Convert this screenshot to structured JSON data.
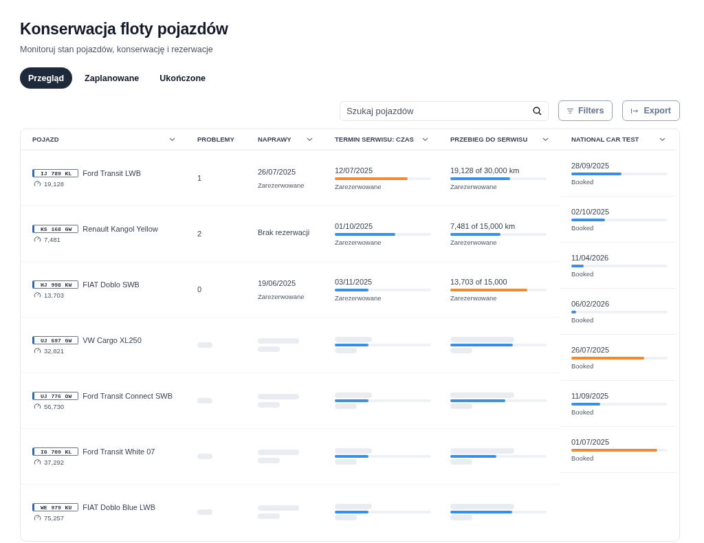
{
  "page": {
    "title": "Konserwacja floty pojazdów",
    "subtitle": "Monitoruj stan pojazdów, konserwację i rezerwacje"
  },
  "tabs": [
    {
      "label": "Przegląd",
      "selected": true
    },
    {
      "label": "Zaplanowane",
      "selected": false
    },
    {
      "label": "Ukończone",
      "selected": false
    }
  ],
  "search": {
    "placeholder": "Szukaj pojazdów"
  },
  "buttons": [
    {
      "label": "Filters",
      "kind": "filter"
    },
    {
      "label": "Export",
      "kind": "export"
    }
  ],
  "table": {
    "columns": [
      {
        "label": "POJAZD"
      },
      {
        "label": "PROBLEMY"
      },
      {
        "label": "NAPRAWY"
      },
      {
        "label": "TERMIN SERWISU: CZAS"
      },
      {
        "label": "PRZEBIEG DO SERWISU"
      },
      {
        "label": "NATIONAL CAR TEST"
      }
    ],
    "rows": [
      {
        "plate": "IJ 789 KL",
        "name": "Ford Transit LWB",
        "odometer": "19,128",
        "loading": false,
        "problems": "1",
        "repair": {
          "date": "26/07/2025",
          "status": "Zarezerwowane"
        },
        "service_time": {
          "text": "12/07/2025",
          "level": 0.76,
          "color": "#f08a35",
          "status": "Zarezerwowane"
        },
        "mileage": {
          "text": "19,128 of 30,000 km",
          "level": 0.62,
          "color": "#3b8ee0",
          "status": "Zarezerwowane"
        }
      },
      {
        "plate": "KS 168 GW",
        "name": "Renault Kangol Yellow",
        "odometer": "7,481",
        "loading": false,
        "problems": "2",
        "repair": {
          "text": "Brak rezerwacji"
        },
        "service_time": {
          "text": "01/10/2025",
          "level": 0.63,
          "color": "#3b8ee0",
          "status": "Zarezerwowane"
        },
        "mileage": {
          "text": "7,481 of 15,000 km",
          "level": 0.52,
          "color": "#3b8ee0",
          "status": "Zarezerwowane"
        }
      },
      {
        "plate": "HJ 998 KW",
        "name": "FIAT Doblo SWB",
        "odometer": "13,703",
        "loading": false,
        "problems": "0",
        "repair": {
          "date": "19/06/2025",
          "status": "Zarezerwowane"
        },
        "service_time": {
          "text": "03/11/2025",
          "level": 0.35,
          "color": "#3b8ee0",
          "status": "Zarezerwowane"
        },
        "mileage": {
          "text": "13,703 of 15,000",
          "level": 0.8,
          "color": "#f08a35",
          "status": "Zarezerwowane"
        }
      },
      {
        "plate": "UJ 597 GW",
        "name": "VW Cargo XL250",
        "odometer": "32,821",
        "loading": true,
        "service_time": {
          "level": 0.35,
          "color": "#3b8ee0"
        },
        "mileage": {
          "level": 0.65,
          "color": "#3b8ee0"
        }
      },
      {
        "plate": "UJ 776 OW",
        "name": "Ford Transit Connect SWB",
        "odometer": "56,730",
        "loading": true,
        "service_time": {
          "level": 0.35,
          "color": "#3b8ee0"
        },
        "mileage": {
          "level": 0.57,
          "color": "#3b8ee0"
        }
      },
      {
        "plate": "IG 709 KL",
        "name": "Ford Transit White 07",
        "odometer": "37,292",
        "loading": true,
        "service_time": {
          "level": 0.35,
          "color": "#3b8ee0"
        },
        "mileage": {
          "level": 0.48,
          "color": "#3b8ee0"
        }
      },
      {
        "plate": "WE 979 KU",
        "name": "FIAT Doblo Blue LWB",
        "odometer": "75,257",
        "loading": true,
        "service_time": {
          "level": 0.35,
          "color": "#3b8ee0"
        },
        "mileage": {
          "level": 0.64,
          "color": "#3b8ee0"
        }
      }
    ],
    "nct": [
      {
        "date": "28/09/2025",
        "level": 0.52,
        "color": "#3b8ee0",
        "status": "Booked"
      },
      {
        "date": "02/10/2025",
        "level": 0.35,
        "color": "#3b8ee0",
        "status": "Booked"
      },
      {
        "date": "11/04/2026",
        "level": 0.13,
        "color": "#3b8ee0",
        "status": "Booked"
      },
      {
        "date": "06/02/2026",
        "level": 0.05,
        "color": "#3b8ee0",
        "status": "Booked"
      },
      {
        "date": "26/07/2025",
        "level": 0.76,
        "color": "#f08a35",
        "status": "Booked"
      },
      {
        "date": "11/09/2025",
        "level": 0.3,
        "color": "#3b8ee0",
        "status": "Booked"
      },
      {
        "date": "01/07/2025",
        "level": 0.89,
        "color": "#f08a35",
        "status": "Booked"
      }
    ]
  }
}
